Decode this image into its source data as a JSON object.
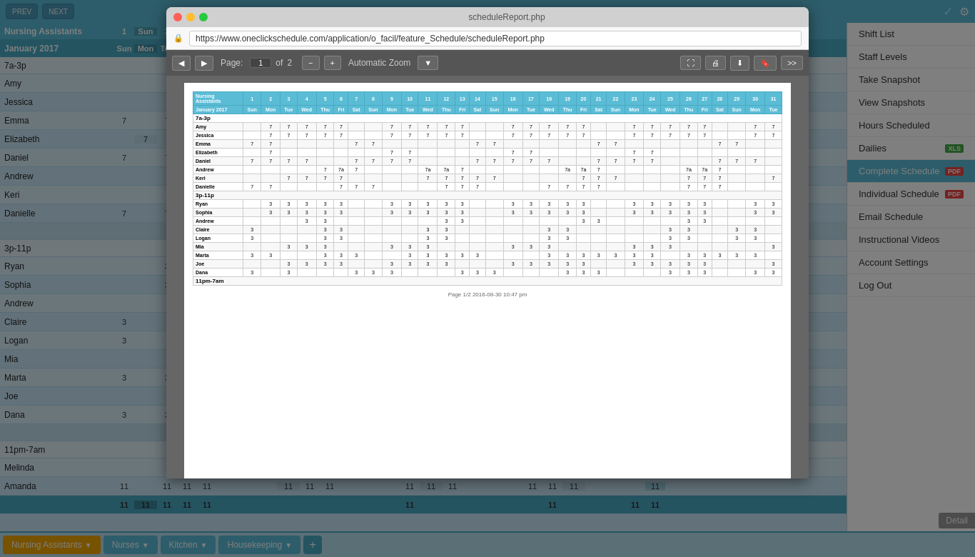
{
  "toolbar": {
    "prev_label": "PREV",
    "next_label": "NEXT",
    "icons": [
      "copy",
      "paste",
      "edit",
      "undo",
      "redo"
    ],
    "check_icon": "✓",
    "gear_icon": "⚙"
  },
  "header": {
    "title": "Nursing Assistants",
    "month": "January 2017",
    "sun_label": "Sun",
    "dates": [
      "1",
      "2",
      "3",
      "4",
      "5",
      "6",
      "7",
      "8",
      "9",
      "10",
      "11",
      "12",
      "13",
      "14",
      "15",
      "16",
      "17",
      "18",
      "19",
      "20",
      "21",
      "22",
      "23",
      "24",
      "25",
      "26",
      "27"
    ],
    "thu_label": "Thu",
    "fri_label": "Fri"
  },
  "menu": {
    "items": [
      {
        "label": "Shift List",
        "badge": null
      },
      {
        "label": "Staff Levels",
        "badge": null
      },
      {
        "label": "Take Snapshot",
        "badge": null
      },
      {
        "label": "View Snapshots",
        "badge": null
      },
      {
        "label": "Hours Scheduled",
        "badge": null
      },
      {
        "label": "Dailies",
        "badge": "XLS"
      },
      {
        "label": "Complete Schedule",
        "badge": "PDF",
        "active": true
      },
      {
        "label": "Individual Schedule",
        "badge": "PDF"
      },
      {
        "label": "Email Schedule",
        "badge": null
      },
      {
        "label": "Instructional Videos",
        "badge": null
      },
      {
        "label": "Account Settings",
        "badge": null
      },
      {
        "label": "Log Out",
        "badge": null
      }
    ]
  },
  "schedule": {
    "section_7a": "7a-3p",
    "section_3p": "3p-11p",
    "section_11p": "11pm-7am",
    "employees_7a": [
      {
        "name": "Amy",
        "vals": [
          "",
          "",
          "",
          "",
          "",
          "",
          "7",
          "7",
          "7",
          "7",
          "7",
          "",
          "",
          "",
          "",
          "",
          "7",
          "7",
          "7",
          "7",
          "7",
          "",
          "",
          "",
          "",
          "7",
          "7"
        ]
      },
      {
        "name": "Jessica",
        "vals": [
          "",
          "",
          "",
          "",
          "",
          "",
          "7",
          "7",
          "7",
          "7",
          "7",
          "",
          "",
          "",
          "",
          "",
          "7",
          "7",
          "7",
          "7",
          "7",
          "",
          "",
          "",
          "",
          "7",
          "7"
        ]
      },
      {
        "name": "Emma",
        "vals": [
          "7",
          "",
          "",
          "",
          "",
          "",
          "",
          "",
          "",
          "",
          "7",
          "7",
          "",
          "",
          "",
          "",
          "",
          "",
          "",
          "7",
          "7",
          "",
          "",
          "",
          "",
          "7",
          "7"
        ]
      },
      {
        "name": "Elizabeth",
        "vals": [
          "",
          "7",
          "",
          "",
          "",
          "",
          "",
          "",
          "",
          "",
          "",
          "7",
          "7",
          "",
          "",
          "",
          "",
          "",
          "",
          "",
          "7",
          "7",
          "",
          "",
          "",
          "",
          ""
        ]
      },
      {
        "name": "Daniel",
        "vals": [
          "7",
          "7",
          "7",
          "7",
          "",
          "",
          "",
          "7",
          "7",
          "7",
          "7",
          "",
          "",
          "",
          "",
          "7",
          "7",
          "7",
          "7",
          "",
          "",
          "",
          "7",
          "7",
          "7",
          "7",
          ""
        ]
      },
      {
        "name": "Andrew",
        "vals": [
          "",
          "",
          "",
          "",
          "7",
          "7a",
          "7",
          "",
          "",
          "",
          "",
          "7a",
          "7a",
          "7",
          "",
          "",
          "",
          "",
          "7a",
          "7a",
          "7",
          "",
          "",
          "",
          "",
          "",
          ""
        ]
      },
      {
        "name": "Keri",
        "vals": [
          "",
          "",
          "7",
          "7",
          "7",
          "7",
          "",
          "",
          "",
          "",
          "",
          "",
          "7",
          "7",
          "7",
          "7",
          "7",
          "",
          "",
          "",
          "",
          "7",
          "7",
          "7",
          "",
          "",
          "7"
        ]
      },
      {
        "name": "Danielle",
        "vals": [
          "7",
          "7",
          "",
          "",
          "",
          "7",
          "7",
          "7",
          "",
          "",
          "",
          "",
          "7",
          "7",
          "7",
          "",
          "",
          "",
          "7",
          "7",
          "7",
          "7",
          "",
          "",
          "",
          "7",
          "7",
          "7"
        ]
      }
    ],
    "employees_3p": [
      {
        "name": "Ryan",
        "vals": [
          "",
          "3",
          "3",
          "3",
          "3",
          "3",
          "",
          "",
          "3",
          "3",
          "3",
          "3",
          "3",
          "",
          "",
          "3",
          "3",
          "3",
          "3",
          "3",
          "",
          "",
          "",
          "3",
          "3",
          "3",
          "3"
        ]
      },
      {
        "name": "Sophia",
        "vals": [
          "",
          "3",
          "3",
          "3",
          "3",
          "3",
          "",
          "",
          "3",
          "3",
          "3",
          "3",
          "3",
          "",
          "",
          "3",
          "3",
          "3",
          "3",
          "3",
          "",
          "",
          "",
          "3",
          "3",
          "3",
          "3"
        ]
      },
      {
        "name": "Andrew",
        "vals": [
          "",
          "",
          "",
          "",
          "3",
          "3",
          "",
          "",
          "",
          "",
          "",
          "",
          "",
          "3",
          "3",
          "",
          "",
          "",
          "",
          "",
          "",
          "",
          "",
          "",
          "",
          "",
          ""
        ]
      },
      {
        "name": "Claire",
        "vals": [
          "3",
          "",
          "",
          "",
          "",
          "3",
          "3",
          "",
          "",
          "",
          "",
          "",
          "3",
          "3",
          "",
          "",
          "",
          "",
          "",
          "3",
          "3",
          "",
          "",
          "",
          "",
          "",
          ""
        ]
      },
      {
        "name": "Logan",
        "vals": [
          "3",
          "",
          "",
          "",
          "",
          "3",
          "3",
          "",
          "",
          "",
          "",
          "",
          "3",
          "3",
          "",
          "",
          "",
          "",
          "",
          "3",
          "3",
          "",
          "",
          "",
          "",
          "3",
          "3"
        ]
      },
      {
        "name": "Mia",
        "vals": [
          "",
          "",
          "3",
          "3",
          "3",
          "",
          "",
          "",
          "3",
          "3",
          "3",
          "",
          "",
          "",
          "",
          "3",
          "3",
          "3",
          "",
          "",
          "",
          "",
          "3",
          "3",
          "3",
          "",
          "",
          "3"
        ]
      },
      {
        "name": "Marta",
        "vals": [
          "3",
          "3",
          "",
          "",
          "",
          "3",
          "3",
          "3",
          "",
          "",
          "3",
          "3",
          "3",
          "3",
          "3",
          "",
          "",
          "",
          "3",
          "3",
          "3",
          "3",
          "3",
          "3",
          "3",
          "",
          "3",
          "3"
        ]
      },
      {
        "name": "Joe",
        "vals": [
          "",
          "",
          "3",
          "3",
          "3",
          "3",
          "3",
          "",
          "",
          "3",
          "3",
          "3",
          "3",
          "3",
          "",
          "",
          "3",
          "3",
          "3",
          "3",
          "3",
          "",
          "",
          "",
          "3",
          "3",
          "3",
          "3"
        ]
      },
      {
        "name": "Dana",
        "vals": [
          "3",
          "",
          "3",
          "",
          "",
          "",
          "3",
          "3",
          "3",
          "",
          "",
          "",
          "3",
          "3",
          "3",
          "",
          "",
          "",
          "3",
          "3",
          "3",
          "",
          "",
          "",
          "3",
          "3",
          "3",
          ""
        ]
      }
    ],
    "employees_11p": [
      {
        "name": "Melinda",
        "vals": [
          "11",
          "",
          "",
          "",
          "",
          "",
          "",
          "",
          "",
          "11",
          "",
          "",
          "",
          "",
          "",
          "",
          "",
          "",
          "",
          "",
          "11",
          "",
          "",
          "11",
          "11"
        ]
      },
      {
        "name": "Amanda",
        "vals": [
          "11",
          "",
          "11",
          "11",
          "11",
          "",
          "",
          "",
          "11",
          "11",
          "11",
          "",
          "",
          "",
          "11",
          "11",
          "11",
          "",
          "",
          "",
          "11",
          "11",
          "11",
          "",
          "",
          "",
          "11"
        ]
      }
    ]
  },
  "right_column": {
    "vals_7a": [
      "7",
      "7",
      "7",
      "7",
      "7",
      "7",
      "7a",
      "7a",
      "7",
      "7",
      "7",
      "7"
    ],
    "vals_3p": [
      "3",
      "3",
      "3",
      "3",
      "3",
      "3",
      "3",
      "3",
      "3"
    ],
    "vals_11p": [
      "11",
      "11"
    ]
  },
  "browser": {
    "url": "https://www.oneclickschedule.com/application/o_facil/feature_Schedule/scheduleReport.php",
    "title": "scheduleReport.php",
    "page_label": "Page:",
    "page_num": "1",
    "page_total": "2",
    "zoom_label": "Automatic Zoom",
    "footer": "Page 1/2  2016-08-30 10:47 pm"
  },
  "tabs": {
    "nursing_label": "Nursing Assistants",
    "nurses_label": "Nurses",
    "kitchen_label": "Kitchen",
    "housekeeping_label": "Housekeeping",
    "add_icon": "+"
  },
  "detail_btn": "Detail"
}
